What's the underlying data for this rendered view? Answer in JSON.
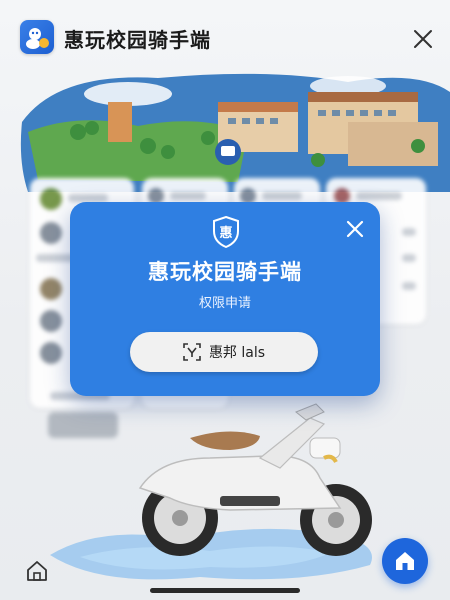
{
  "header": {
    "title": "惠玩校园骑手端",
    "logo_icon": "mascot-logo-icon",
    "close_icon": "close-icon"
  },
  "dialog": {
    "badge_char": "惠",
    "title": "惠玩校园骑手端",
    "subtitle": "权限申请",
    "auth_button_label": "惠邦 lals",
    "auth_icon": "scan-icon",
    "close_icon": "close-icon",
    "background": "#2f7fe2"
  },
  "bottom": {
    "home_icon": "home-icon"
  },
  "colors": {
    "accent": "#1e66dc",
    "dialog": "#2f7fe2"
  }
}
